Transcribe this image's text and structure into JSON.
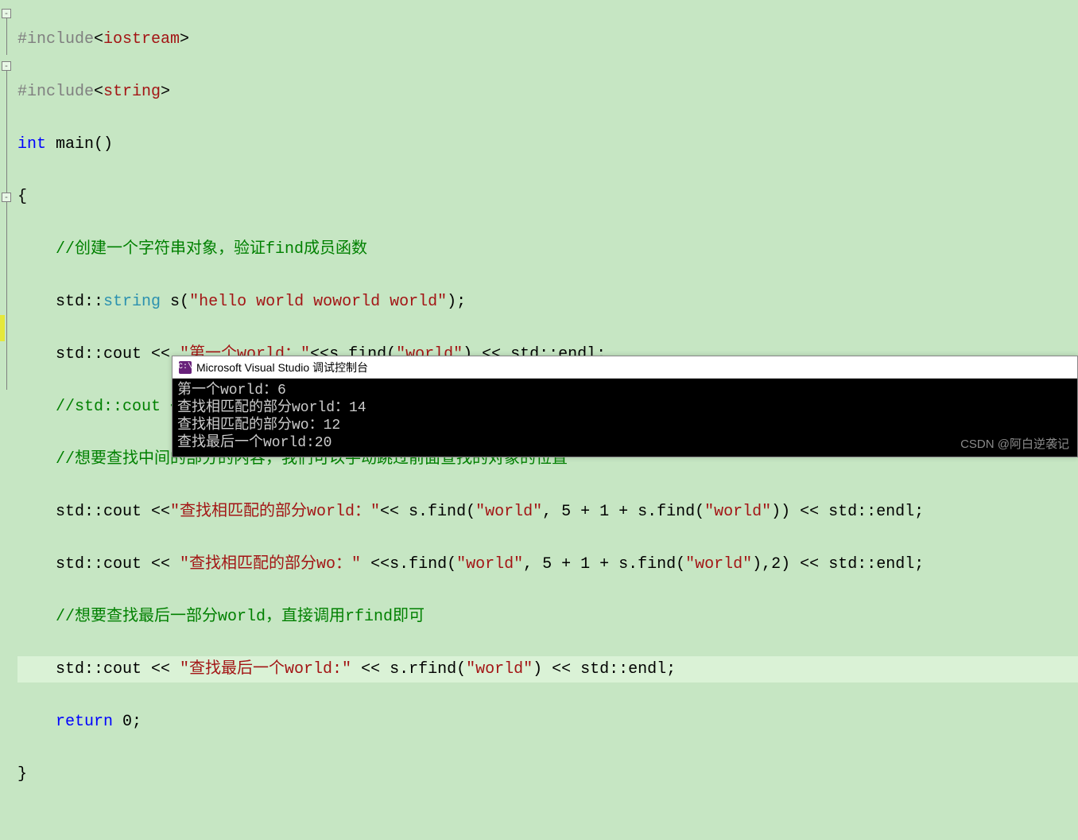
{
  "code": {
    "l1": {
      "pre": "#include",
      "open": "<",
      "hdr": "iostream",
      "close": ">"
    },
    "l2": {
      "pre": "#include",
      "open": "<",
      "hdr": "string",
      "close": ">"
    },
    "l3": {
      "kw": "int",
      "fn": "main",
      "paren": "()"
    },
    "l4": "{",
    "l5": "    //创建一个字符串对象，验证find成员函数",
    "l6": {
      "a": "    std::",
      "b": "string",
      "c": " s(",
      "d": "\"hello world woworld world\"",
      "e": ");"
    },
    "l7": {
      "a": "    std::cout << ",
      "b": "\"第一个world：\"",
      "c": "<<s.find(",
      "d": "\"world\"",
      "e": ") << std::endl;"
    },
    "l8": "    //std::cout << s.find(\"aaaaa\") << std::endl;",
    "l9": "    //想要查找中间的部分的内容，我们可以手动跳过前面查找的对象的位置",
    "l10": {
      "a": "    std::cout <<",
      "b": "\"查找相匹配的部分world：\"",
      "c": "<< s.find(",
      "d": "\"world\"",
      "e": ", 5 + 1 + s.find(",
      "f": "\"world\"",
      "g": ")) << std::endl;"
    },
    "l11": {
      "a": "    std::cout << ",
      "b": "\"查找相匹配的部分wo：\"",
      "c": " <<s.find(",
      "d": "\"world\"",
      "e": ", 5 + 1 + s.find(",
      "f": "\"world\"",
      "g": "),2) << std::endl;"
    },
    "l12": "    //想要查找最后一部分world，直接调用rfind即可",
    "l13": {
      "a": "    std::cout << ",
      "b": "\"查找最后一个world:\"",
      "c": " << s.rfind(",
      "d": "\"world\"",
      "e": ") << std::endl;"
    },
    "l14": {
      "a": "    ",
      "b": "return",
      "c": " 0;"
    },
    "l15": "}"
  },
  "fold": {
    "sym": "-"
  },
  "console": {
    "title": "Microsoft Visual Studio 调试控制台",
    "icon": "C:\\",
    "lines": [
      "第一个world：6",
      "查找相匹配的部分world：14",
      "查找相匹配的部分wo：12",
      "查找最后一个world:20"
    ]
  },
  "watermark": "CSDN @阿白逆袭记"
}
